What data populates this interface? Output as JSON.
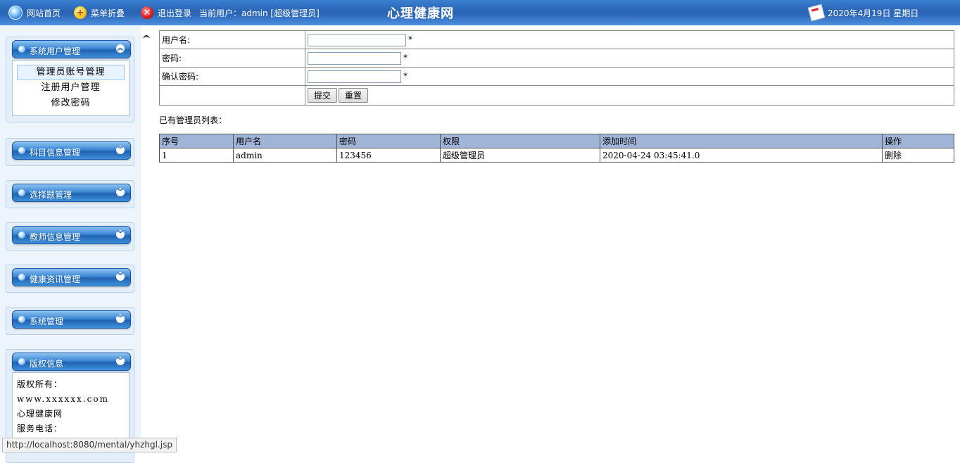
{
  "topbar": {
    "home_label": "网站首页",
    "collapse_label": "菜单折叠",
    "logout_label": "退出登录",
    "current_user": "当前用户：admin [超级管理员]",
    "site_title": "心理健康网",
    "date_text": "2020年4月19日 星期日"
  },
  "sidebar": {
    "sections": [
      {
        "title": "系统用户管理",
        "toggle": "up",
        "items": [
          "管理员账号管理",
          "注册用户管理",
          "修改密码"
        ]
      },
      {
        "title": "科目信息管理",
        "toggle": "down"
      },
      {
        "title": "选择题管理",
        "toggle": "down"
      },
      {
        "title": "教师信息管理",
        "toggle": "down"
      },
      {
        "title": "健康资讯管理",
        "toggle": "down"
      },
      {
        "title": "系统管理",
        "toggle": "down"
      },
      {
        "title": "版权信息",
        "toggle": "down",
        "lines": [
          "版权所有：",
          "www.xxxxxx.com",
          "心理健康网",
          "服务电话："
        ]
      }
    ]
  },
  "form": {
    "username_label": "用户名:",
    "password_label": "密码:",
    "confirm_label": "确认密码:",
    "required_mark": "*",
    "username_value": "",
    "password_value": "",
    "confirm_value": "",
    "submit_label": "提交",
    "reset_label": "重置"
  },
  "list": {
    "title": "已有管理员列表：",
    "columns": [
      "序号",
      "用户名",
      "密码",
      "权限",
      "添加时间",
      "操作"
    ],
    "rows": [
      [
        "1",
        "admin",
        "123456",
        "超级管理员",
        "2020-04-24 03:45:41.0",
        "删除"
      ]
    ]
  },
  "status_url": "http://localhost:8080/mental/yhzhgl.jsp"
}
